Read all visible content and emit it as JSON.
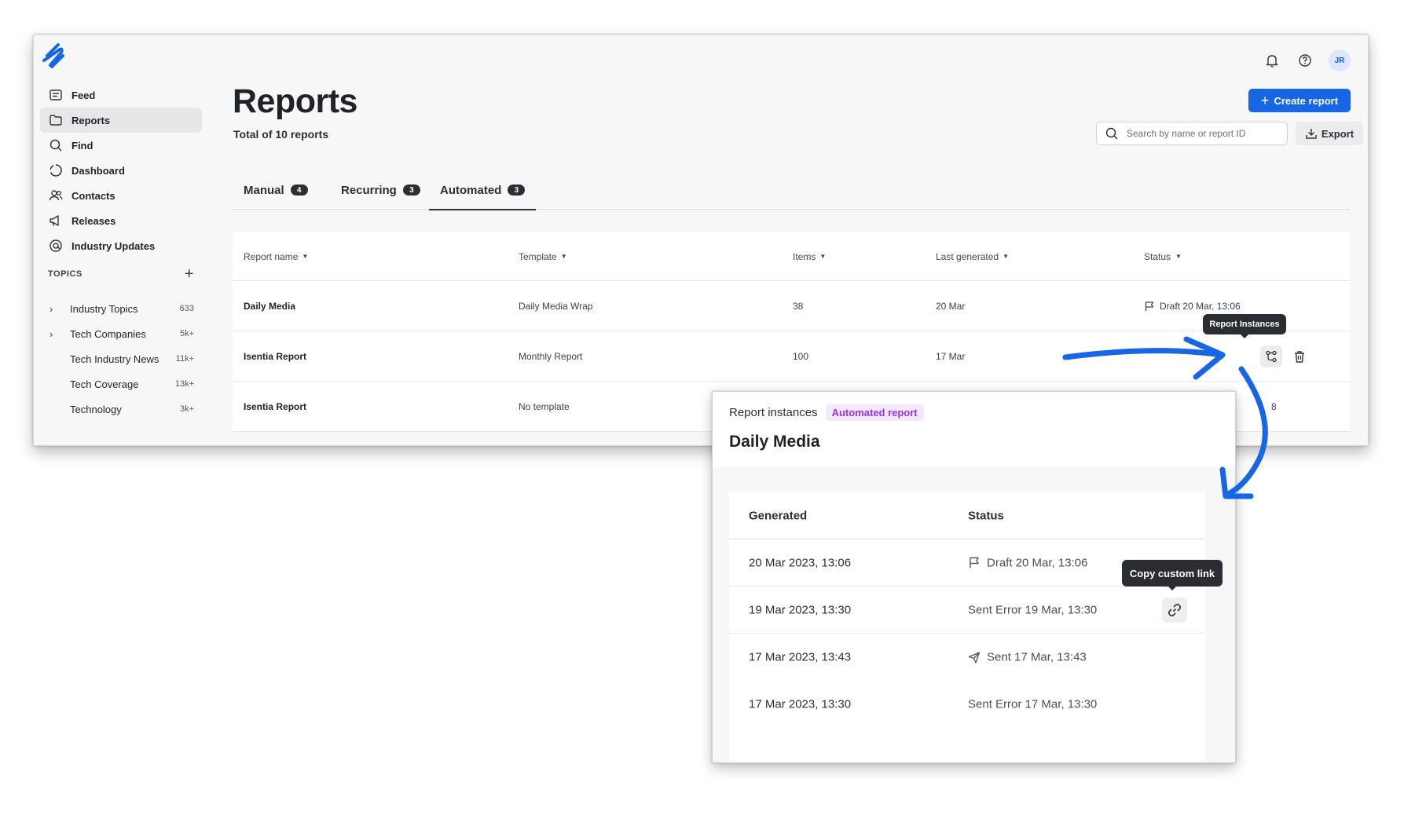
{
  "colors": {
    "accent": "#1766e6",
    "arrow": "#1766e6",
    "pill_bg": "#f3e8ff",
    "pill_text": "#9333ea"
  },
  "header": {
    "avatar_initials": "JR",
    "create_label": "Create report",
    "search_placeholder": "Search by name or report ID",
    "export_label": "Export"
  },
  "sidebar": {
    "items": [
      {
        "label": "Feed",
        "icon": "feed-icon"
      },
      {
        "label": "Reports",
        "icon": "folder-icon"
      },
      {
        "label": "Find",
        "icon": "search-icon"
      },
      {
        "label": "Dashboard",
        "icon": "dashboard-icon"
      },
      {
        "label": "Contacts",
        "icon": "contacts-icon"
      },
      {
        "label": "Releases",
        "icon": "megaphone-icon"
      },
      {
        "label": "Industry Updates",
        "icon": "at-icon"
      }
    ],
    "topics_heading": "TOPICS",
    "topics": [
      {
        "name": "Industry Topics",
        "count": "633"
      },
      {
        "name": "Tech Companies",
        "count": "5k+"
      },
      {
        "name": "Tech Industry News",
        "count": "11k+"
      },
      {
        "name": "Tech Coverage",
        "count": "13k+"
      },
      {
        "name": "Technology",
        "count": "3k+"
      }
    ]
  },
  "main": {
    "title": "Reports",
    "subtitle": "Total of 10 reports",
    "tabs": [
      {
        "label": "Manual",
        "count": "4"
      },
      {
        "label": "Recurring",
        "count": "3"
      },
      {
        "label": "Automated",
        "count": "3"
      }
    ],
    "columns": [
      "Report name",
      "Template",
      "Items",
      "Last generated",
      "Status"
    ],
    "rows": [
      {
        "name": "Daily Media",
        "template": "Daily Media Wrap",
        "items": "38",
        "last": "20 Mar",
        "status": "Draft 20 Mar, 13:06"
      },
      {
        "name": "Isentia Report",
        "template": "Monthly Report",
        "items": "100",
        "last": "17 Mar",
        "status": ""
      },
      {
        "name": "Isentia Report",
        "template": "No template",
        "items": "",
        "last": "",
        "status": "8"
      }
    ],
    "tooltip_instances": "Report Instances"
  },
  "panel": {
    "kicker": "Report instances",
    "pill": "Automated report",
    "title": "Daily Media",
    "columns": [
      "Generated",
      "Status"
    ],
    "rows": [
      {
        "generated": "20 Mar 2023, 13:06",
        "status": "Draft 20 Mar, 13:06",
        "icon": "flag-icon"
      },
      {
        "generated": "19 Mar 2023, 13:30",
        "status": "Sent Error 19 Mar, 13:30",
        "icon": ""
      },
      {
        "generated": "17 Mar 2023, 13:43",
        "status": "Sent 17 Mar, 13:43",
        "icon": "send-icon"
      },
      {
        "generated": "17 Mar 2023, 13:30",
        "status": "Sent Error 17 Mar, 13:30",
        "icon": ""
      }
    ],
    "tooltip_copy": "Copy custom link"
  }
}
